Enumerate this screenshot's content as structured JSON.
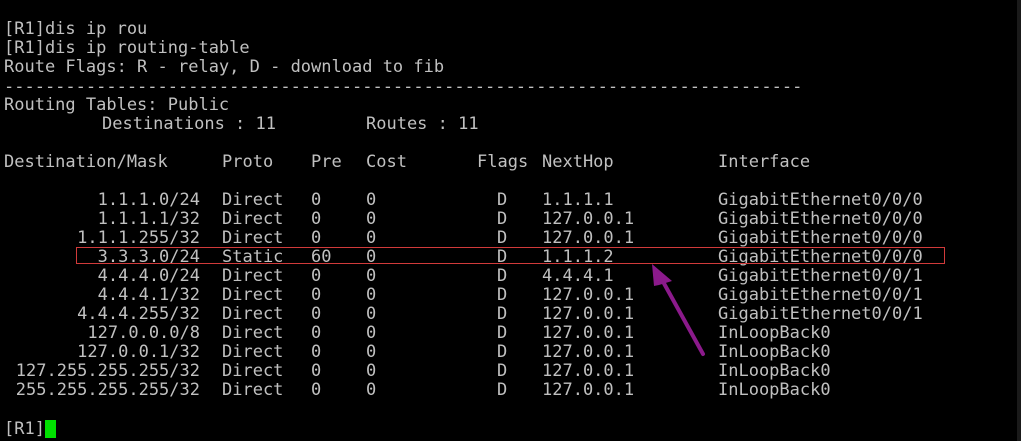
{
  "terminal": {
    "lines": [
      "[R1]dis ip rou",
      "[R1]dis ip routing-table",
      "Route Flags: R - relay, D - download to fib",
      "------------------------------------------------------------------------------",
      "Routing Tables: Public"
    ],
    "summary": {
      "destinations_label": "Destinations : 11",
      "routes_label": "Routes : 11"
    },
    "headers": {
      "destination": "Destination/Mask",
      "proto": "Proto",
      "pre": "Pre",
      "cost": "Cost",
      "flags": "Flags",
      "nexthop": "NextHop",
      "interface": "Interface"
    },
    "routes": [
      {
        "dest": "1.1.1.0/24",
        "proto": "Direct",
        "pre": "0",
        "cost": "0",
        "flags": "D",
        "nexthop": "1.1.1.1",
        "iface": "GigabitEthernet0/0/0"
      },
      {
        "dest": "1.1.1.1/32",
        "proto": "Direct",
        "pre": "0",
        "cost": "0",
        "flags": "D",
        "nexthop": "127.0.0.1",
        "iface": "GigabitEthernet0/0/0"
      },
      {
        "dest": "1.1.1.255/32",
        "proto": "Direct",
        "pre": "0",
        "cost": "0",
        "flags": "D",
        "nexthop": "127.0.0.1",
        "iface": "GigabitEthernet0/0/0"
      },
      {
        "dest": "3.3.3.0/24",
        "proto": "Static",
        "pre": "60",
        "cost": "0",
        "flags": "D",
        "nexthop": "1.1.1.2",
        "iface": "GigabitEthernet0/0/0"
      },
      {
        "dest": "4.4.4.0/24",
        "proto": "Direct",
        "pre": "0",
        "cost": "0",
        "flags": "D",
        "nexthop": "4.4.4.1",
        "iface": "GigabitEthernet0/0/1"
      },
      {
        "dest": "4.4.4.1/32",
        "proto": "Direct",
        "pre": "0",
        "cost": "0",
        "flags": "D",
        "nexthop": "127.0.0.1",
        "iface": "GigabitEthernet0/0/1"
      },
      {
        "dest": "4.4.4.255/32",
        "proto": "Direct",
        "pre": "0",
        "cost": "0",
        "flags": "D",
        "nexthop": "127.0.0.1",
        "iface": "GigabitEthernet0/0/1"
      },
      {
        "dest": "127.0.0.0/8",
        "proto": "Direct",
        "pre": "0",
        "cost": "0",
        "flags": "D",
        "nexthop": "127.0.0.1",
        "iface": "InLoopBack0"
      },
      {
        "dest": "127.0.0.1/32",
        "proto": "Direct",
        "pre": "0",
        "cost": "0",
        "flags": "D",
        "nexthop": "127.0.0.1",
        "iface": "InLoopBack0"
      },
      {
        "dest": "127.255.255.255/32",
        "proto": "Direct",
        "pre": "0",
        "cost": "0",
        "flags": "D",
        "nexthop": "127.0.0.1",
        "iface": "InLoopBack0"
      },
      {
        "dest": "255.255.255.255/32",
        "proto": "Direct",
        "pre": "0",
        "cost": "0",
        "flags": "D",
        "nexthop": "127.0.0.1",
        "iface": "InLoopBack0"
      }
    ],
    "prompt": "[R1]",
    "colors": {
      "background": "#000000",
      "text": "#c0c0c0",
      "cursor": "#00e000",
      "highlight_box": "#d13a3a",
      "arrow": "#8b1a8b"
    }
  }
}
